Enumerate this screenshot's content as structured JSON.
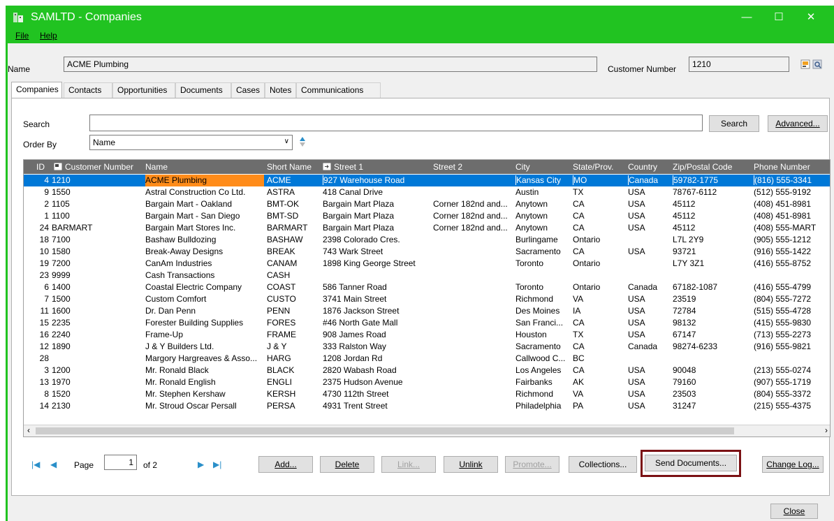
{
  "window": {
    "title": "SAMLTD - Companies",
    "min": "—",
    "max": "☐",
    "close": "✕"
  },
  "menu": {
    "file": "File",
    "help": "Help"
  },
  "header": {
    "name_label": "Name",
    "name_value": "ACME Plumbing",
    "custnum_label": "Customer Number",
    "custnum_value": "1210"
  },
  "tabs": [
    "Companies",
    "Contacts",
    "Opportunities",
    "Documents",
    "Cases",
    "Notes",
    "Communications"
  ],
  "search": {
    "label": "Search",
    "value": "",
    "button": "Search",
    "advanced": "Advanced..."
  },
  "orderby": {
    "label": "Order By",
    "value": "Name"
  },
  "columns": [
    "ID",
    "Customer Number",
    "Name",
    "Short Name",
    "Street 1",
    "Street 2",
    "City",
    "State/Prov.",
    "Country",
    "Zip/Postal Code",
    "Phone Number"
  ],
  "rows": [
    [
      "4",
      "1210",
      "ACME Plumbing",
      "ACME",
      "927 Warehouse Road",
      "",
      "Kansas City",
      "MO",
      "Canada",
      "59782-1775",
      "(816) 555-3341"
    ],
    [
      "9",
      "1550",
      "Astral Construction Co Ltd.",
      "ASTRA",
      "418 Canal Drive",
      "",
      "Austin",
      "TX",
      "USA",
      "78767-6112",
      "(512) 555-9192"
    ],
    [
      "2",
      "1105",
      "Bargain Mart - Oakland",
      "BMT-OK",
      "Bargain Mart Plaza",
      "Corner 182nd and...",
      "Anytown",
      "CA",
      "USA",
      "45112",
      "(408) 451-8981"
    ],
    [
      "1",
      "1100",
      "Bargain Mart - San Diego",
      "BMT-SD",
      "Bargain Mart Plaza",
      "Corner 182nd and...",
      "Anytown",
      "CA",
      "USA",
      "45112",
      "(408) 451-8981"
    ],
    [
      "24",
      "BARMART",
      "Bargain Mart Stores Inc.",
      "BARMART",
      "Bargain Mart Plaza",
      "Corner 182nd and...",
      "Anytown",
      "CA",
      "USA",
      "45112",
      "(408) 555-MART"
    ],
    [
      "18",
      "7100",
      "Bashaw Bulldozing",
      "BASHAW",
      "2398 Colorado Cres.",
      "",
      "Burlingame",
      "Ontario",
      "",
      "L7L 2Y9",
      "(905) 555-1212"
    ],
    [
      "10",
      "1580",
      "Break-Away Designs",
      "BREAK",
      "743 Wark Street",
      "",
      "Sacramento",
      "CA",
      "USA",
      "93721",
      "(916) 555-1422"
    ],
    [
      "19",
      "7200",
      "CanAm Industries",
      "CANAM",
      "1898 King George Street",
      "",
      "Toronto",
      "Ontario",
      "",
      "L7Y 3Z1",
      "(416) 555-8752"
    ],
    [
      "23",
      "9999",
      "Cash Transactions",
      "CASH",
      "",
      "",
      "",
      "",
      "",
      "",
      ""
    ],
    [
      "6",
      "1400",
      "Coastal Electric Company",
      "COAST",
      "586 Tanner Road",
      "",
      "Toronto",
      "Ontario",
      "Canada",
      "67182-1087",
      "(416) 555-4799"
    ],
    [
      "7",
      "1500",
      "Custom Comfort",
      "CUSTO",
      "3741 Main Street",
      "",
      "Richmond",
      "VA",
      "USA",
      "23519",
      "(804) 555-7272"
    ],
    [
      "11",
      "1600",
      "Dr. Dan Penn",
      "PENN",
      "1876 Jackson Street",
      "",
      "Des Moines",
      "IA",
      "USA",
      "72784",
      "(515) 555-4728"
    ],
    [
      "15",
      "2235",
      "Forester Building Supplies",
      "FORES",
      "#46 North Gate Mall",
      "",
      "San Franci...",
      "CA",
      "USA",
      "98132",
      "(415) 555-9830"
    ],
    [
      "16",
      "2240",
      "Frame-Up",
      "FRAME",
      "908 James Road",
      "",
      "Houston",
      "TX",
      "USA",
      "67147",
      "(713) 555-2273"
    ],
    [
      "12",
      "1890",
      "J & Y Builders Ltd.",
      "J & Y",
      "333 Ralston Way",
      "",
      "Sacramento",
      "CA",
      "Canada",
      "98274-6233",
      "(916) 555-9821"
    ],
    [
      "28",
      "",
      "Margory Hargreaves & Asso...",
      "HARG",
      "1208 Jordan Rd",
      "",
      "Callwood C...",
      "BC",
      "",
      "",
      ""
    ],
    [
      "3",
      "1200",
      "Mr. Ronald Black",
      "BLACK",
      "2820 Wabash Road",
      "",
      "Los Angeles",
      "CA",
      "USA",
      "90048",
      "(213) 555-0274"
    ],
    [
      "13",
      "1970",
      "Mr. Ronald English",
      "ENGLI",
      "2375 Hudson Avenue",
      "",
      "Fairbanks",
      "AK",
      "USA",
      "79160",
      "(907) 555-1719"
    ],
    [
      "8",
      "1520",
      "Mr. Stephen Kershaw",
      "KERSH",
      "4730 112th Street",
      "",
      "Richmond",
      "VA",
      "USA",
      "23503",
      "(804) 555-3372"
    ],
    [
      "14",
      "2130",
      "Mr. Stroud Oscar Persall",
      "PERSA",
      "4931 Trent Street",
      "",
      "Philadelphia",
      "PA",
      "USA",
      "31247",
      "(215) 555-4375"
    ]
  ],
  "pager": {
    "page_label": "Page",
    "page_value": "1",
    "of_label": "of 2"
  },
  "buttons": {
    "add": "Add...",
    "delete": "Delete",
    "link": "Link...",
    "unlink": "Unlink",
    "promote": "Promote...",
    "collections": "Collections...",
    "send": "Send Documents...",
    "changelog": "Change Log...",
    "close": "Close"
  },
  "colors": {
    "titlebar": "#21c321",
    "selected_row": "#0078d7",
    "selected_name": "#ff8c1a",
    "header": "#6d6d6d",
    "highlight_box": "#7b1114"
  }
}
